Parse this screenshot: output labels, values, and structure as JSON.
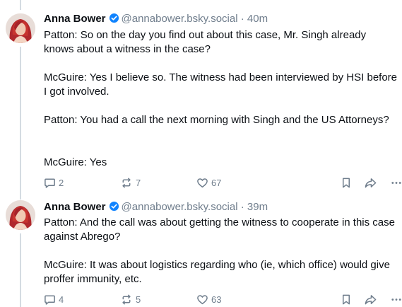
{
  "posts": [
    {
      "author": {
        "name": "Anna Bower",
        "handle": "@annabower.bsky.social"
      },
      "separator": "·",
      "time": "40m",
      "body": [
        "Patton: So on the day you find out about this case, Mr. Singh already knows about a witness in the case?",
        "McGuire: Yes I believe so. The witness had been interviewed by HSI before I got involved.",
        "Patton: You had a call the next morning with Singh and the US Attorneys?",
        "McGuire: Yes"
      ],
      "stats": {
        "replies": "2",
        "reposts": "7",
        "likes": "67"
      }
    },
    {
      "author": {
        "name": "Anna Bower",
        "handle": "@annabower.bsky.social"
      },
      "separator": "·",
      "time": "39m",
      "body": [
        "Patton: And the call was about getting the witness to cooperate in this case against Abrego?",
        "McGuire: It was about logistics regarding who (ie, which office) would give proffer immunity, etc."
      ],
      "stats": {
        "replies": "4",
        "reposts": "5",
        "likes": "63"
      }
    }
  ],
  "icons": {
    "verified": "verified-check-icon",
    "reply": "speech-bubble-icon",
    "repost": "repost-arrows-icon",
    "like": "heart-icon",
    "bookmark": "bookmark-icon",
    "share": "share-arrow-icon",
    "more": "ellipsis-icon"
  },
  "colors": {
    "text": "#0b0f14",
    "muted": "#6f7d8c",
    "verified": "#1083fe",
    "thread_line": "#d4dbe2"
  }
}
